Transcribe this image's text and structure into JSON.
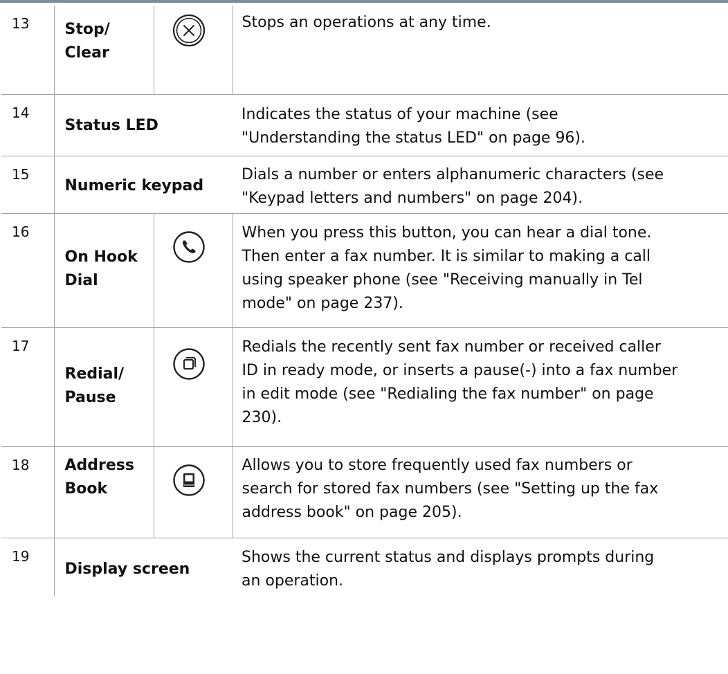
{
  "rows": [
    {
      "num": "13",
      "name": [
        "Stop/",
        "Clear"
      ],
      "icon": "stop-clear-icon",
      "desc": [
        "Stops an operations at any time."
      ]
    },
    {
      "num": "14",
      "name": [
        "Status LED"
      ],
      "icon": null,
      "desc": [
        "Indicates the status of your machine (see",
        "\"Understanding the status LED\" on page 96)."
      ]
    },
    {
      "num": "15",
      "name": [
        "Numeric keypad"
      ],
      "icon": null,
      "desc": [
        "Dials a number or enters alphanumeric characters (see",
        "\"Keypad letters and numbers\" on page 204)."
      ]
    },
    {
      "num": "16",
      "name": [
        "On Hook",
        "Dial"
      ],
      "icon": "phone-icon",
      "desc": [
        "When you press this button, you can hear a dial tone.",
        "Then enter a fax number. It is similar to making a call",
        "using speaker phone (see \"Receiving manually in Tel",
        "mode\" on page 237)."
      ]
    },
    {
      "num": "17",
      "name": [
        "Redial/",
        "Pause"
      ],
      "icon": "redial-pause-icon",
      "desc": [
        "Redials the recently sent fax number or received caller",
        "ID in ready mode, or inserts a pause(-) into a fax number",
        "in edit mode (see \"Redialing the fax number\" on page",
        "230)."
      ]
    },
    {
      "num": "18",
      "name": [
        "Address",
        "Book"
      ],
      "icon": "address-book-icon",
      "desc": [
        "Allows you to store frequently used fax numbers or",
        "search for stored fax numbers (see \"Setting up the fax",
        "address book\" on page 205)."
      ]
    },
    {
      "num": "19",
      "name": [
        "Display screen"
      ],
      "icon": null,
      "desc": [
        "Shows the current status and displays prompts during",
        "an operation."
      ]
    }
  ]
}
